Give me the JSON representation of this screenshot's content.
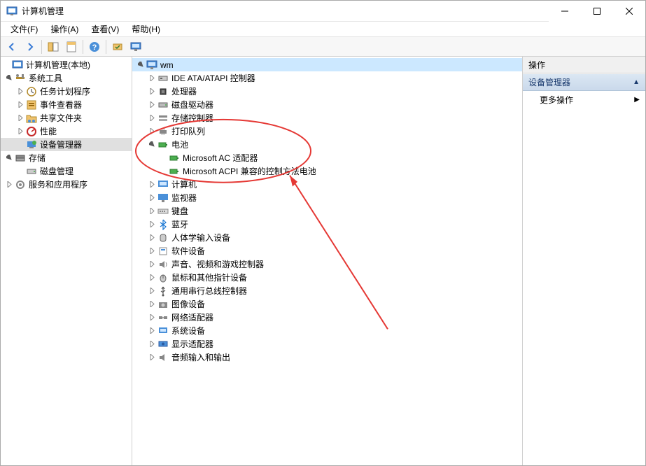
{
  "window": {
    "title": "计算机管理",
    "controls": {
      "minimize": "Minimize",
      "maximize": "Maximize",
      "close": "Close"
    }
  },
  "menu": {
    "file": "文件(F)",
    "action": "操作(A)",
    "view": "查看(V)",
    "help": "帮助(H)"
  },
  "toolbar": {
    "back": "Back",
    "forward": "Forward",
    "up": "Up one level",
    "show_hide_tree": "Show/Hide Console Tree",
    "properties": "Properties",
    "refresh": "Refresh",
    "help": "Help",
    "scan": "Scan for hardware changes",
    "monitor": "Devices and Printers"
  },
  "left_tree": {
    "root": "计算机管理(本地)",
    "system_tools": "系统工具",
    "task_scheduler": "任务计划程序",
    "event_viewer": "事件查看器",
    "shared_folders": "共享文件夹",
    "performance": "性能",
    "device_manager": "设备管理器",
    "storage": "存储",
    "disk_management": "磁盘管理",
    "services_apps": "服务和应用程序"
  },
  "center_tree": {
    "computer_name": "wm",
    "ide_atapi": "IDE ATA/ATAPI 控制器",
    "processors": "处理器",
    "disk_drives": "磁盘驱动器",
    "storage_controllers": "存储控制器",
    "print_queues": "打印队列",
    "batteries": "电池",
    "battery_ac": "Microsoft AC 适配器",
    "battery_acpi": "Microsoft ACPI 兼容的控制方法电池",
    "computer": "计算机",
    "monitors": "监视器",
    "keyboards": "键盘",
    "bluetooth": "蓝牙",
    "hid": "人体学输入设备",
    "software_devices": "软件设备",
    "sound": "声音、视频和游戏控制器",
    "mice": "鼠标和其他指针设备",
    "usb_controllers": "通用串行总线控制器",
    "imaging": "图像设备",
    "network_adapters": "网络适配器",
    "system_devices": "系统设备",
    "display_adapters": "显示适配器",
    "audio_io": "音频输入和输出"
  },
  "actions": {
    "header": "操作",
    "device_manager": "设备管理器",
    "more_actions": "更多操作"
  }
}
